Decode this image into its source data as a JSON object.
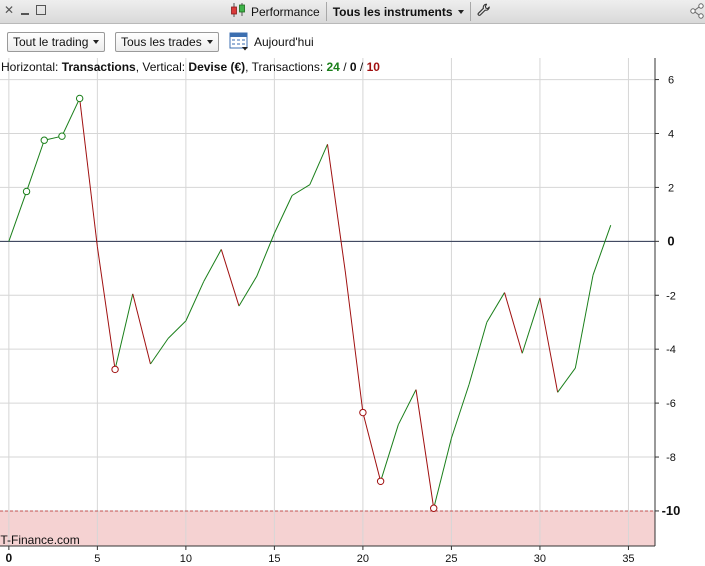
{
  "window": {
    "close_icon": "close-x-icon",
    "minimize_icon": "minimize-icon",
    "maximize_icon": "maximize-icon",
    "panel_title": "Performance",
    "panel_icon": "candlestick-chart-icon",
    "instruments_label": "Tous les instruments",
    "settings_icon": "wrench-icon",
    "share_icon": "share-icon"
  },
  "toolbar": {
    "trading_dropdown": "Tout le trading",
    "trades_dropdown": "Tous les trades",
    "calendar_icon": "calendar-icon",
    "date_label": "Aujourd'hui"
  },
  "chart_header": {
    "horizontal_prefix": "Horizontal: ",
    "horizontal_value": "Transactions",
    "vertical_prefix": ", Vertical: ",
    "vertical_value": "Devise (€)",
    "transactions_prefix": ", Transactions: ",
    "wins": "24",
    "sep1": " / ",
    "neutral": "0",
    "sep2": " / ",
    "losses": "10"
  },
  "watermark": "IT-Finance.com",
  "colors": {
    "gain": "#1a7f1a",
    "loss": "#a01010",
    "limit_zone": "#f5d2d2",
    "limit_line": "#c05050",
    "zero_line": "#2b3550"
  },
  "chart_data": {
    "type": "line",
    "x": [
      0,
      1,
      2,
      3,
      4,
      5,
      6,
      7,
      8,
      9,
      10,
      11,
      12,
      13,
      14,
      15,
      16,
      17,
      18,
      19,
      20,
      21,
      22,
      23,
      24,
      25,
      26,
      27,
      28,
      29,
      30,
      31,
      32,
      33,
      34
    ],
    "y": [
      0,
      1.85,
      3.75,
      3.9,
      5.3,
      -0.2,
      -4.75,
      -1.95,
      -4.55,
      -3.6,
      -2.95,
      -1.5,
      -0.3,
      -2.4,
      -1.3,
      0.3,
      1.7,
      2.1,
      3.6,
      -1.1,
      -6.35,
      -8.9,
      -6.8,
      -5.5,
      -9.9,
      -7.3,
      -5.3,
      -3,
      -1.9,
      -4.15,
      -2.1,
      -5.6,
      -4.7,
      -1.25,
      0.6
    ],
    "marked_points": [
      1,
      2,
      3,
      4,
      6,
      20,
      21,
      24
    ],
    "xlim": [
      -0.5,
      36.5
    ],
    "ylim": [
      -11.3,
      6.8
    ],
    "x_ticks": [
      0,
      5,
      10,
      15,
      20,
      25,
      30,
      35
    ],
    "y_ticks": [
      6,
      4,
      2,
      0,
      -2,
      -4,
      -6,
      -8,
      -10
    ],
    "x_tick_labels": [
      "0",
      "5",
      "10",
      "15",
      "20",
      "25",
      "30",
      "35"
    ],
    "y_tick_labels": [
      "6",
      "4",
      "2",
      "0",
      "-2",
      "-4",
      "-6",
      "-8",
      "-10"
    ],
    "bold_y_ticks": [
      0,
      -10
    ],
    "zero_line": 0,
    "limit_line": -10,
    "grid": true
  }
}
